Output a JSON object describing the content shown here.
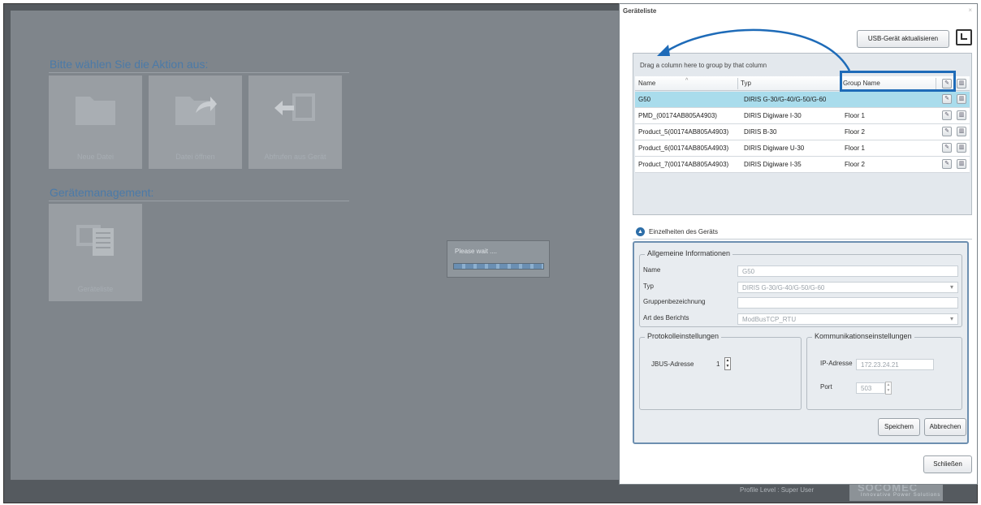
{
  "background_app": {
    "action_section_title": "Bitte wählen Sie die Aktion aus:",
    "tiles": [
      {
        "label": "Neue Datei"
      },
      {
        "label": "Datei öffnen"
      },
      {
        "label": "Abfrufen aus Gerät"
      }
    ],
    "device_section_title": "Gerätemanagement:",
    "device_tile_label": "Geräteliste",
    "please_wait": "Please wait ....",
    "profile_level": "Profile Level : Super User",
    "brand_name": "SOCOMEC",
    "brand_tagline": "Innovative Power Solutions"
  },
  "dialog": {
    "title": "Geräteliste",
    "close_glyph": "×",
    "usb_button": "USB-Gerät aktualisieren",
    "group_hint": "Drag a column here to group by that column",
    "columns": [
      "Name",
      "Typ",
      "Group Name"
    ],
    "rows": [
      {
        "name": "G50",
        "typ": "DIRIS G-30/G-40/G-50/G-60",
        "group": "",
        "selected": true
      },
      {
        "name": "PMD_(00174AB805A4903)",
        "typ": "DIRIS Digiware I-30",
        "group": "Floor 1",
        "selected": false
      },
      {
        "name": "Product_5(00174AB805A4903)",
        "typ": "DIRIS B-30",
        "group": "Floor 2",
        "selected": false
      },
      {
        "name": "Product_6(00174AB805A4903)",
        "typ": "DIRIS Digiware U-30",
        "group": "Floor 1",
        "selected": false
      },
      {
        "name": "Product_7(00174AB805A4903)",
        "typ": "DIRIS Digiware I-35",
        "group": "Floor 2",
        "selected": false
      }
    ],
    "details": {
      "header": "Einzelheiten des Geräts",
      "general_legend": "Allgemeine Informationen",
      "name_label": "Name",
      "name_value": "G50",
      "typ_label": "Typ",
      "typ_value": "DIRIS G-30/G-40/G-50/G-60",
      "group_label": "Gruppenbezeichnung",
      "group_value": "",
      "report_label": "Art des Berichts",
      "report_value": "ModBusTCP_RTU",
      "protocol_legend": "Protokolleinstellungen",
      "jbus_label": "JBUS-Adresse",
      "jbus_value": "1",
      "comm_legend": "Kommunikationseinstellungen",
      "ip_label": "IP-Adresse",
      "ip_value": "172.23.24.21",
      "port_label": "Port",
      "port_value": "503",
      "save_button": "Speichern",
      "cancel_button": "Abbrechen"
    },
    "close_button": "Schließen"
  },
  "colors": {
    "accent": "#1e6bb8",
    "selected_row": "#a9dcec",
    "overlay": "#7f858b"
  }
}
